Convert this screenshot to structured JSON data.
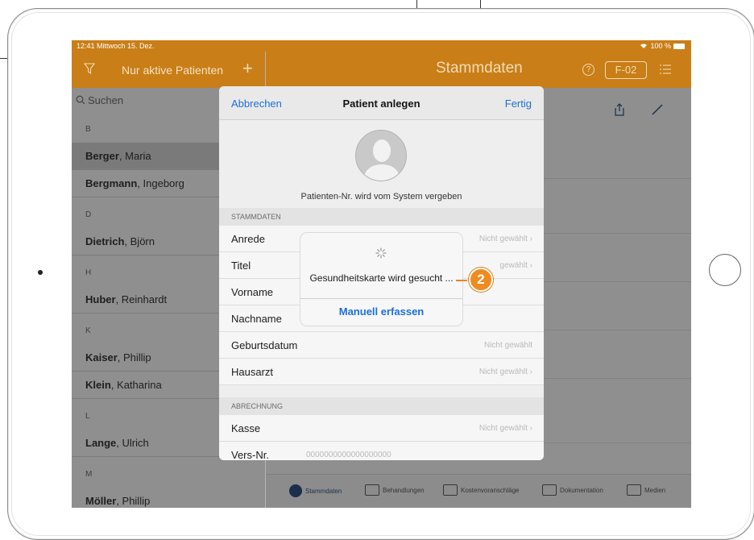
{
  "status_bar": {
    "time": "12:41  Mittwoch 15. Dez.",
    "battery": "100 %"
  },
  "sidebar_nav": {
    "title": "Nur aktive Patienten",
    "add": "+"
  },
  "detail_nav": {
    "title": "Stammdaten",
    "help": "?",
    "id_badge": "F-02"
  },
  "search": {
    "placeholder": "Suchen"
  },
  "patients": [
    {
      "type": "section",
      "label": "B"
    },
    {
      "type": "item",
      "last": "Berger",
      "first": ", Maria",
      "selected": true
    },
    {
      "type": "item",
      "last": "Bergmann",
      "first": ", Ingeborg"
    },
    {
      "type": "section",
      "label": "D"
    },
    {
      "type": "item",
      "last": "Dietrich",
      "first": ", Björn"
    },
    {
      "type": "section",
      "label": "H"
    },
    {
      "type": "item",
      "last": "Huber",
      "first": ", Reinhardt"
    },
    {
      "type": "section",
      "label": "K"
    },
    {
      "type": "item",
      "last": "Kaiser",
      "first": ", Phillip"
    },
    {
      "type": "item",
      "last": "Klein",
      "first": ", Katharina"
    },
    {
      "type": "section",
      "label": "L"
    },
    {
      "type": "item",
      "last": "Lange",
      "first": ", Ulrich"
    },
    {
      "type": "section",
      "label": "M"
    },
    {
      "type": "item",
      "last": "Möller",
      "first": ", Phillip"
    }
  ],
  "tabs": [
    {
      "label": "Stammdaten",
      "active": true
    },
    {
      "label": "Behandlungen"
    },
    {
      "label": "Kostenvoranschläge"
    },
    {
      "label": "Dokumentation"
    },
    {
      "label": "Medien"
    }
  ],
  "modal": {
    "cancel": "Abbrechen",
    "title": "Patient anlegen",
    "done": "Fertig",
    "patient_number_note": "Patienten-Nr. wird vom System vergeben",
    "section_stammdaten": "STAMMDATEN",
    "rows": {
      "anrede": {
        "label": "Anrede",
        "value": "Nicht gewählt ›"
      },
      "titel": {
        "label": "Titel",
        "value": "gewählt ›"
      },
      "vorname": {
        "label": "Vorname"
      },
      "nachname": {
        "label": "Nachname"
      },
      "geburtsdatum": {
        "label": "Geburtsdatum",
        "value": "Nicht gewählt"
      },
      "hausarzt": {
        "label": "Hausarzt",
        "value": "Nicht gewählt ›"
      }
    },
    "section_abrechnung": "ABRECHNUNG",
    "billing": {
      "kasse": {
        "label": "Kasse",
        "value": "Nicht gewählt ›"
      },
      "versnr": {
        "label": "Vers-Nr.",
        "value": "0000000000000000000"
      }
    }
  },
  "alert": {
    "message": "Gesundheitskarte wird gesucht ...",
    "button": "Manuell erfassen"
  },
  "callout": {
    "number": "2"
  },
  "colors": {
    "accent": "#c97e17",
    "link": "#1d6fd6",
    "callout": "#f08a1f"
  }
}
